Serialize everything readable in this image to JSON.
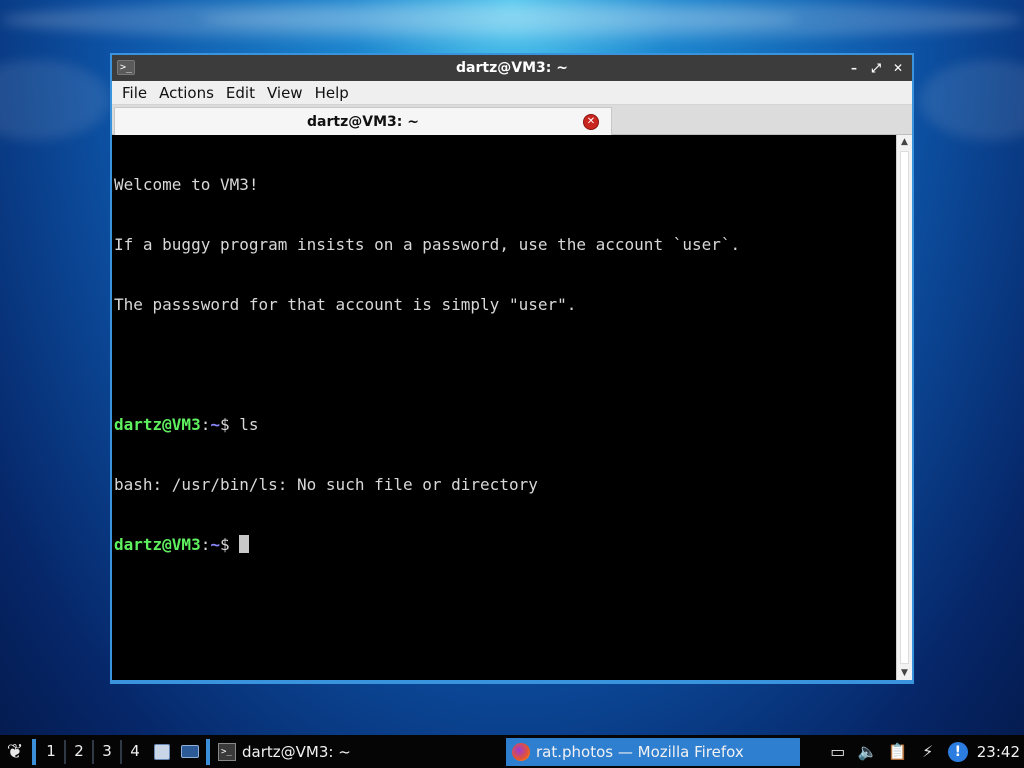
{
  "window": {
    "title": "dartz@VM3: ~",
    "terminal_icon": ">_",
    "controls": {
      "minimize": "–",
      "maximize": "⤢",
      "close": "✕"
    }
  },
  "menubar": {
    "items": [
      "File",
      "Actions",
      "Edit",
      "View",
      "Help"
    ]
  },
  "tab": {
    "label": "dartz@VM3: ~",
    "close": "✕"
  },
  "terminal": {
    "welcome": "Welcome to VM3!",
    "line2": "If a buggy program insists on a password, use the account `user`.",
    "line3": "The passsword for that account is simply \"user\".",
    "prompt_user": "dartz@VM3",
    "prompt_colon": ":",
    "prompt_path": "~",
    "prompt_dollar": "$ ",
    "command1": "ls",
    "output1": "bash: /usr/bin/ls: No such file or directory",
    "colors": {
      "user": "#5ff05f",
      "path": "#8a8aff",
      "text": "#d8d8d8",
      "background": "#000000"
    }
  },
  "scrollbar": {
    "up": "▲",
    "down": "▼"
  },
  "taskbar": {
    "start_icon": "menu-icon",
    "workspaces": [
      "1",
      "2",
      "3",
      "4"
    ],
    "tasks": [
      {
        "label": "dartz@VM3: ~",
        "icon": "terminal-icon",
        "active": false
      },
      {
        "label": "rat.photos — Mozilla Firefox",
        "icon": "firefox-icon",
        "active": true
      }
    ],
    "tray": [
      "document-icon",
      "volume-icon",
      "clipboard-icon",
      "network-icon",
      "notification-icon"
    ],
    "clock": "23:42",
    "accent": "#2f7fd1"
  }
}
